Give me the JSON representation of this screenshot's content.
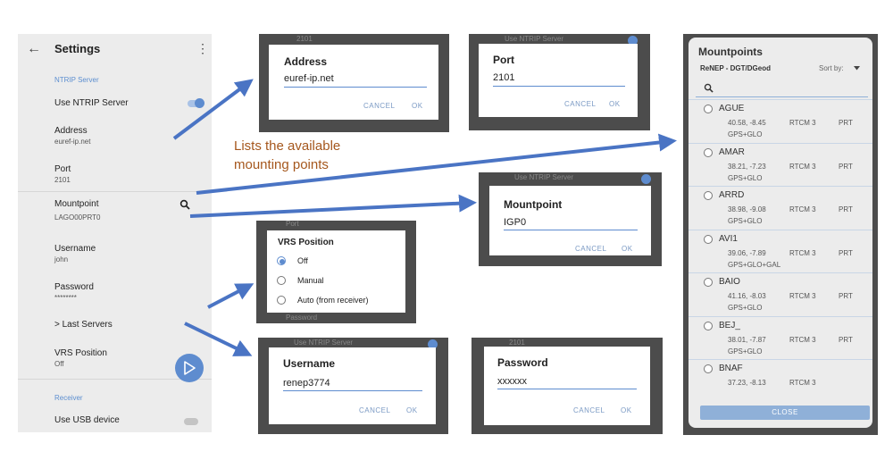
{
  "settings": {
    "title": "Settings",
    "back_glyph": "←",
    "menu_glyph": "⋮",
    "ntrip_header": "NTRIP Server",
    "use_ntrip": "Use NTRIP Server",
    "address_label": "Address",
    "address_value": "euref-ip.net",
    "port_label": "Port",
    "port_value": "2101",
    "mountpoint_label": "Mountpoint",
    "mountpoint_value": "LAGO00PRT0",
    "username_label": "Username",
    "username_value": "john",
    "password_label": "Password",
    "password_value": "********",
    "last_servers": "> Last Servers",
    "vrs_label": "VRS Position",
    "vrs_value": "Off",
    "receiver_header": "Receiver",
    "use_usb": "Use USB device"
  },
  "caption": {
    "line1": "Lists the available",
    "line2": "mounting points"
  },
  "dialogs": {
    "address": {
      "title": "Address",
      "value": "euref-ip.net",
      "cancel": "CANCEL",
      "ok": "OK",
      "behind": "2101"
    },
    "port": {
      "title": "Port",
      "value": "2101",
      "cancel": "CANCEL",
      "ok": "OK",
      "behind": "Use NTRIP Server"
    },
    "mountpoint": {
      "title": "Mountpoint",
      "value": "IGP0",
      "cancel": "CANCEL",
      "ok": "OK",
      "behind": "Use NTRIP Server"
    },
    "vrs": {
      "title": "VRS Position",
      "options": [
        "Off",
        "Manual",
        "Auto (from receiver)"
      ],
      "selected_index": 0,
      "behind_top": "Port",
      "behind_bottom": "Password"
    },
    "username": {
      "title": "Username",
      "value": "renep3774",
      "cancel": "CANCEL",
      "ok": "OK",
      "behind": "Use NTRIP Server"
    },
    "password": {
      "title": "Password",
      "value": "xxxxxx",
      "cancel": "CANCEL",
      "ok": "OK",
      "behind": "2101"
    }
  },
  "mountpoints": {
    "title": "Mountpoints",
    "caster": "ReNEP - DGT/DGeod",
    "sort_label": "Sort by:",
    "close": "CLOSE",
    "items": [
      {
        "name": "AGUE",
        "coords": "40.58, -8.45",
        "format": "RTCM 3",
        "country": "PRT",
        "systems": "GPS+GLO"
      },
      {
        "name": "AMAR",
        "coords": "38.21, -7.23",
        "format": "RTCM 3",
        "country": "PRT",
        "systems": "GPS+GLO"
      },
      {
        "name": "ARRD",
        "coords": "38.98, -9.08",
        "format": "RTCM 3",
        "country": "PRT",
        "systems": "GPS+GLO"
      },
      {
        "name": "AVI1",
        "coords": "39.06, -7.89",
        "format": "RTCM 3",
        "country": "PRT",
        "systems": "GPS+GLO+GAL"
      },
      {
        "name": "BAIO",
        "coords": "41.16, -8.03",
        "format": "RTCM 3",
        "country": "PRT",
        "systems": "GPS+GLO"
      },
      {
        "name": "BEJ_",
        "coords": "38.01, -7.87",
        "format": "RTCM 3",
        "country": "PRT",
        "systems": "GPS+GLO"
      },
      {
        "name": "BNAF",
        "coords": "37.23, -8.13",
        "format": "RTCM 3",
        "country": "",
        "systems": ""
      }
    ]
  },
  "colors": {
    "accent": "#5e8ccf",
    "arrow": "#4a74c4",
    "caption": "#a5571d",
    "frame": "#4c4c4c"
  }
}
